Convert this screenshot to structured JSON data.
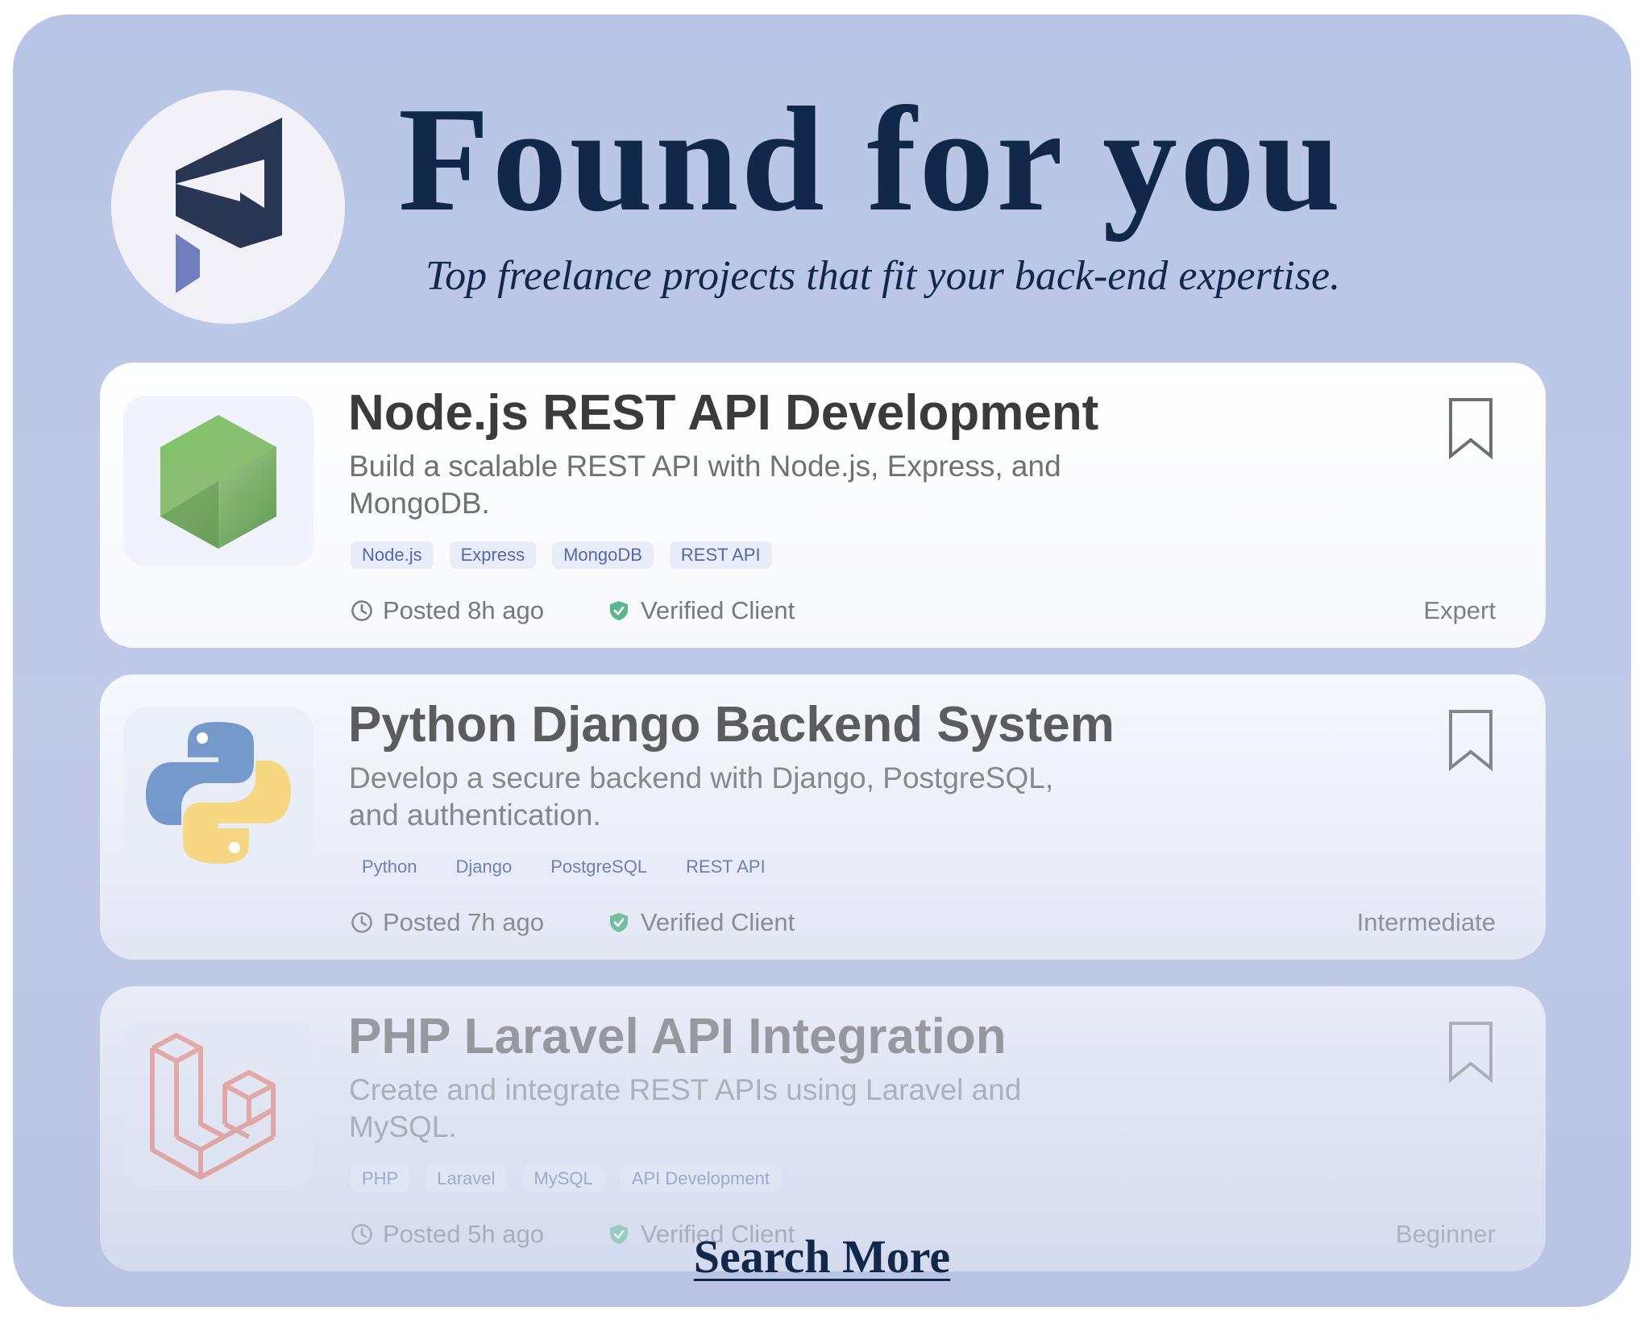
{
  "header": {
    "title": "Found for you",
    "subtitle": "Top freelance projects that fit your back-end expertise.",
    "logo_icon": "brand-logo-icon"
  },
  "colors": {
    "background": "#b8c5e6",
    "title": "#12284a",
    "tag_text": "#5669a6",
    "verified": "#4fae85",
    "nodejs": "#6fae5f",
    "python_blue": "#3a6ea8",
    "python_yellow": "#f6cc55",
    "laravel": "#e2604e"
  },
  "projects": [
    {
      "title": "Node.js REST API Development",
      "description": "Build a scalable REST API with Node.js, Express, and MongoDB.",
      "tags": [
        "Node.js",
        "Express",
        "MongoDB",
        "REST API"
      ],
      "posted": "Posted 8h ago",
      "verified": "Verified Client",
      "level": "Expert",
      "icon": "nodejs-icon"
    },
    {
      "title": "Python Django Backend System",
      "description": "Develop a secure backend with Django, PostgreSQL, and authentication.",
      "tags": [
        "Python",
        "Django",
        "PostgreSQL",
        "REST API"
      ],
      "posted": "Posted 7h ago",
      "verified": "Verified Client",
      "level": "Intermediate",
      "icon": "python-icon"
    },
    {
      "title": "PHP Laravel API Integration",
      "description": "Create and integrate REST APIs using Laravel and MySQL.",
      "tags": [
        "PHP",
        "Laravel",
        "MySQL",
        "API Development"
      ],
      "posted": "Posted 5h ago",
      "verified": "Verified Client",
      "level": "Beginner",
      "icon": "laravel-icon"
    }
  ],
  "footer": {
    "search_more": "Search More"
  }
}
